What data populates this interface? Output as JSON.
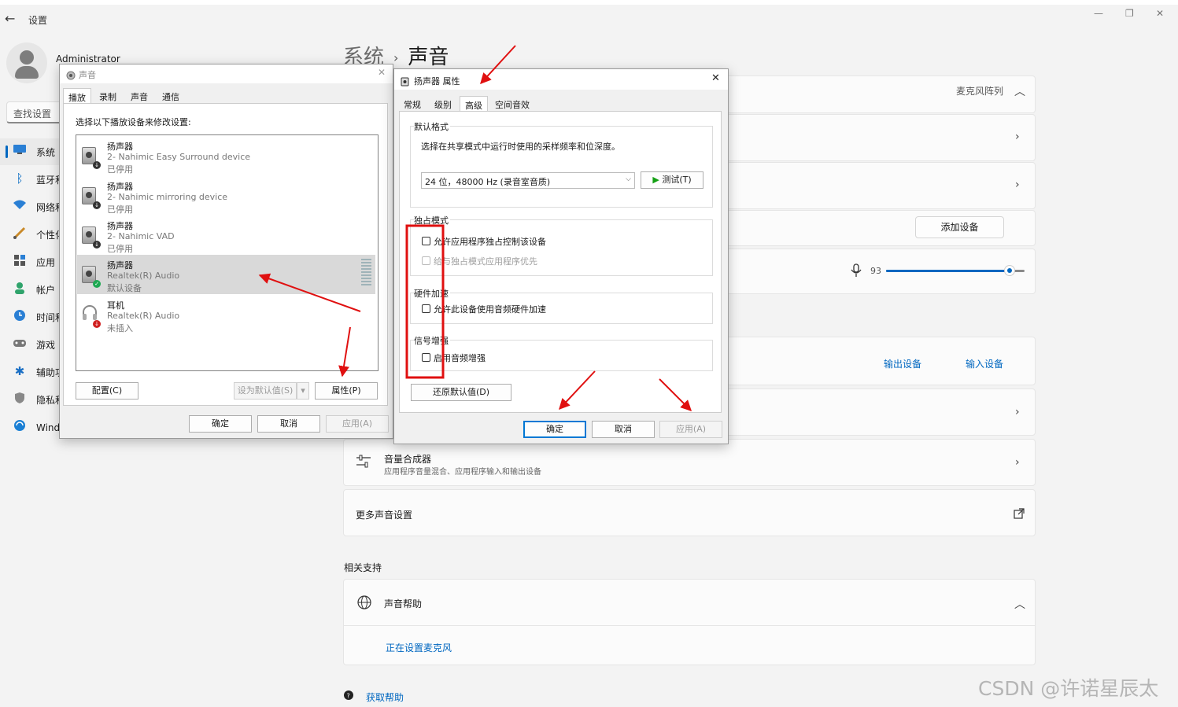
{
  "app": {
    "title": "设置",
    "user_name": "Administrator",
    "search_placeholder": "查找设置"
  },
  "nav": [
    {
      "label": "系统",
      "icon": "monitor-icon"
    },
    {
      "label": "蓝牙和其他设备",
      "icon": "bluetooth-icon"
    },
    {
      "label": "网络和 Internet",
      "icon": "wifi-icon"
    },
    {
      "label": "个性化",
      "icon": "brush-icon"
    },
    {
      "label": "应用",
      "icon": "apps-icon"
    },
    {
      "label": "帐户",
      "icon": "person-icon"
    },
    {
      "label": "时间和语言",
      "icon": "clock-globe-icon"
    },
    {
      "label": "游戏",
      "icon": "gamepad-icon"
    },
    {
      "label": "辅助功能",
      "icon": "accessibility-icon"
    },
    {
      "label": "隐私和安全性",
      "icon": "shield-icon"
    },
    {
      "label": "Windows 更新",
      "icon": "update-icon"
    }
  ],
  "breadcrumb": {
    "parent": "系统",
    "separator": "›",
    "current": "声音"
  },
  "main": {
    "mic_array": "麦克风阵列",
    "add_device": "添加设备",
    "volume": "93",
    "volume_level": 0.89,
    "output_devices_link": "输出设备",
    "input_devices_link": "输入设备",
    "mixer_title": "音量合成器",
    "mixer_sub": "应用程序音量混合、应用程序输入和输出设备",
    "more_settings": "更多声音设置",
    "related_heading": "相关支持",
    "help_title": "声音帮助",
    "help_link": "正在设置麦克风",
    "get_help": "获取帮助"
  },
  "sound_dialog": {
    "title": "声音",
    "tabs": [
      "播放",
      "录制",
      "声音",
      "通信"
    ],
    "instruction": "选择以下播放设备来修改设置:",
    "devices": [
      {
        "name": "扬声器",
        "device": "2- Nahimic Easy Surround device",
        "status": "已停用"
      },
      {
        "name": "扬声器",
        "device": "2- Nahimic mirroring device",
        "status": "已停用"
      },
      {
        "name": "扬声器",
        "device": "2- Nahimic VAD",
        "status": "已停用"
      },
      {
        "name": "扬声器",
        "device": "Realtek(R) Audio",
        "status": "默认设备"
      },
      {
        "name": "耳机",
        "device": "Realtek(R) Audio",
        "status": "未插入"
      }
    ],
    "configure": "配置(C)",
    "set_default": "设为默认值(S)",
    "properties": "属性(P)",
    "ok": "确定",
    "cancel": "取消",
    "apply": "应用(A)"
  },
  "props_dialog": {
    "title": "扬声器 属性",
    "tabs": [
      "常规",
      "级别",
      "高级",
      "空间音效"
    ],
    "default_format": {
      "label": "默认格式",
      "desc": "选择在共享模式中运行时使用的采样频率和位深度。",
      "selected": "24 位，48000 Hz (录音室音质)",
      "test": "测试(T)"
    },
    "exclusive": {
      "label": "独占模式",
      "opt1": "允许应用程序独占控制该设备",
      "opt2": "给与独占模式应用程序优先"
    },
    "hw_accel": {
      "label": "硬件加速",
      "opt1": "允许此设备使用音频硬件加速"
    },
    "enhance": {
      "label": "信号增强",
      "opt1": "启用音频增强"
    },
    "restore": "还原默认值(D)",
    "ok": "确定",
    "cancel": "取消",
    "apply": "应用(A)"
  },
  "watermark": "CSDN @许诺星辰太",
  "colors": {
    "accent": "#0067c0",
    "annotation": "#e01010"
  }
}
